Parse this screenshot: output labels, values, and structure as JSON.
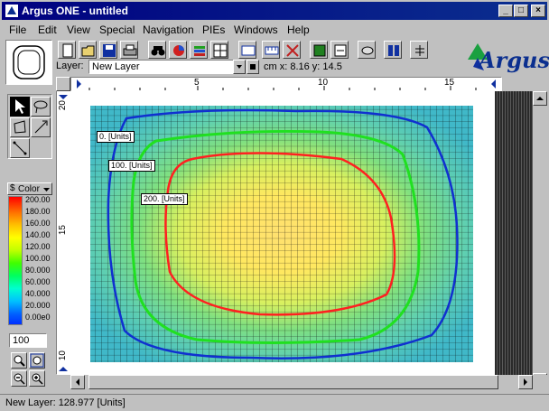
{
  "window": {
    "title": "Argus ONE - untitled",
    "min": "_",
    "max": "□",
    "close": "×"
  },
  "menu": [
    "File",
    "Edit",
    "View",
    "Special",
    "Navigation",
    "PIEs",
    "Windows",
    "Help"
  ],
  "toolbar": {
    "icons": [
      "new-icon",
      "open-icon",
      "save-icon",
      "print-icon",
      "find-icon",
      "pie-icon",
      "layers-icon",
      "grid-icon",
      "domain-icon",
      "ruler-icon",
      "mesh-icon",
      "book-icon",
      "export-icon",
      "import-icon",
      "report-icon",
      "tree-icon"
    ],
    "layer_label": "Layer:",
    "layer_value": "New Layer",
    "coords": "cm x: 8.16    y: 14.5"
  },
  "logo": {
    "text": "Argus"
  },
  "ruler": {
    "h_ticks": [
      "5",
      "10",
      "15"
    ],
    "v_ticks": [
      "20",
      "15",
      "10"
    ]
  },
  "contour_labels": [
    "0. [Units]",
    "100. [Units]",
    "200. [Units]"
  ],
  "legend": {
    "header": "Color",
    "values": [
      "200.00",
      "180.00",
      "160.00",
      "140.00",
      "120.00",
      "100.00",
      "80.000",
      "60.000",
      "40.000",
      "20.000",
      "0.00e0"
    ],
    "colors": {
      "max": "#ff0000",
      "mid": "#ffff00",
      "low": "#00ff00",
      "min": "#0000ff"
    }
  },
  "zoom": {
    "value": "100"
  },
  "status": {
    "text": "New Layer: 128.977 [Units]"
  }
}
